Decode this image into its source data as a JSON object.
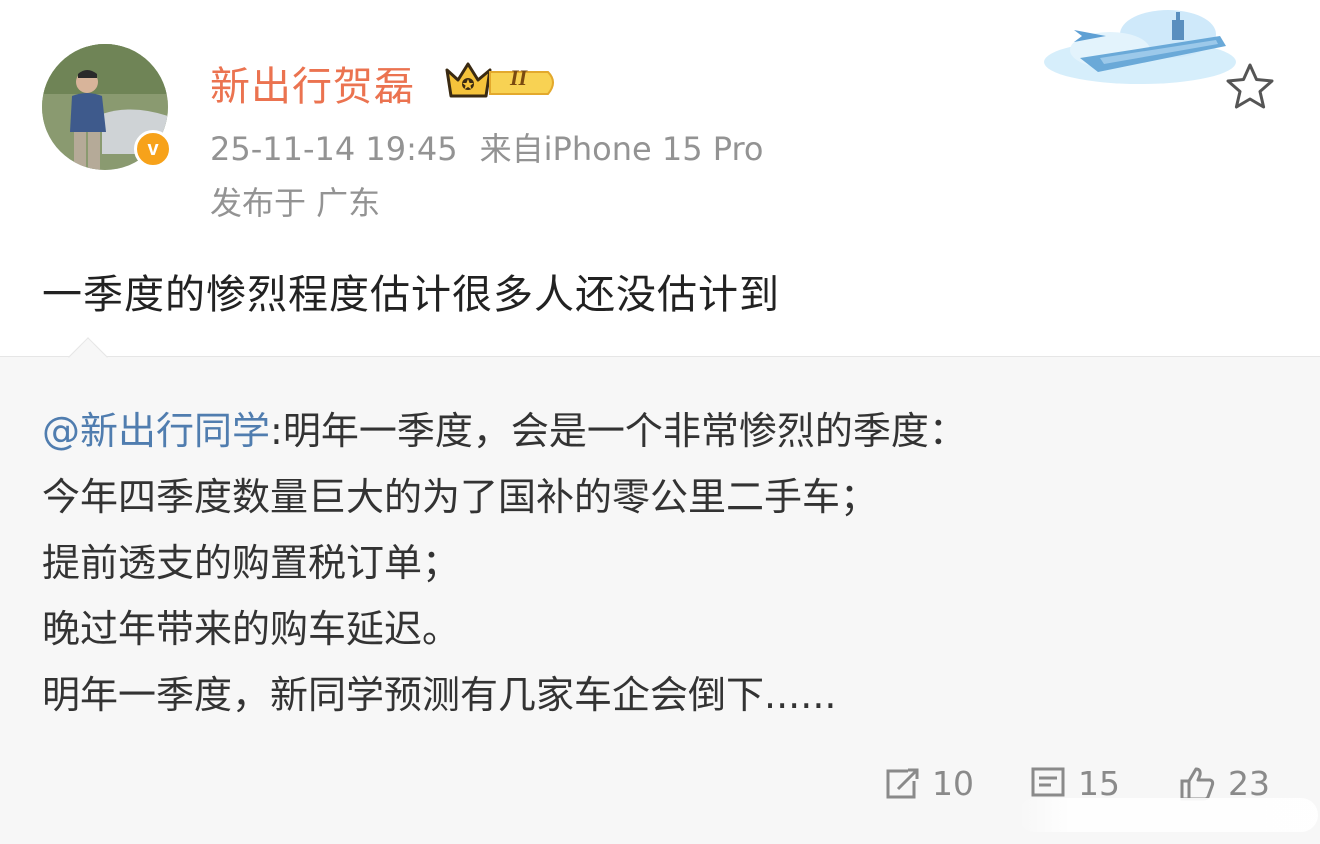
{
  "header": {
    "username": "新出行贺磊",
    "vip_level": "II",
    "timestamp": "25-11-14 19:45",
    "source": "来自iPhone 15 Pro",
    "location": "发布于 广东",
    "verified_mark": "v"
  },
  "post": {
    "text": "一季度的惨烈程度估计很多人还没估计到"
  },
  "repost": {
    "mention": "@新出行同学",
    "lines": [
      ":明年一季度，会是一个非常惨烈的季度：",
      "今年四季度数量巨大的为了国补的零公里二手车；",
      "提前透支的购置税订单；",
      "晚过年带来的购车延迟。",
      "明年一季度，新同学预测有几家车企会倒下......"
    ]
  },
  "actions": {
    "repost_count": "10",
    "comment_count": "15",
    "like_count": "23"
  },
  "icons": {
    "favorite": "star-outline-icon",
    "repost": "repost-icon",
    "comment": "comment-icon",
    "like": "thumb-up-icon",
    "crown": "crown-icon",
    "decoration": "aircraft-carrier-cloud-decoration"
  },
  "colors": {
    "username": "#eb7350",
    "meta": "#939393",
    "mention": "#507daf",
    "repost_bg": "#f7f7f7",
    "verified": "#f7a21a",
    "vip_gold": "#f5c33b"
  }
}
